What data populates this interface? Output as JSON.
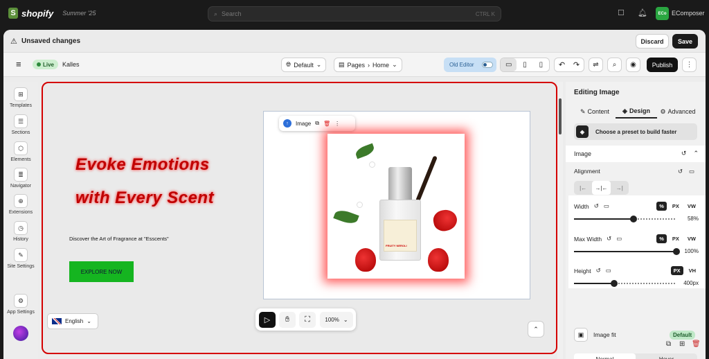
{
  "topbar": {
    "brand": "shopify",
    "store": "Summer '25",
    "search_placeholder": "Search",
    "shortcut": "CTRL K",
    "app_badge": "ECo",
    "app_name": "EComposer"
  },
  "unsaved": {
    "title": "Unsaved changes",
    "discard": "Discard",
    "save": "Save"
  },
  "toolbar": {
    "status": "Live",
    "shop": "Kalles",
    "theme": "Default",
    "page_group": "Pages",
    "page": "Home",
    "old_editor": "Old Editor",
    "publish": "Publish"
  },
  "leftbar": {
    "items": [
      {
        "label": "Templates",
        "icon": "templates-icon"
      },
      {
        "label": "Sections",
        "icon": "sections-icon"
      },
      {
        "label": "Elements",
        "icon": "elements-icon"
      },
      {
        "label": "Navigator",
        "icon": "navigator-icon"
      },
      {
        "label": "Extensions",
        "icon": "extensions-icon"
      },
      {
        "label": "History",
        "icon": "history-icon"
      },
      {
        "label": "Site Settings",
        "icon": "site-settings-icon"
      },
      {
        "label": "App Settings",
        "icon": "app-settings-icon"
      }
    ]
  },
  "canvas": {
    "heading_line1": "Evoke Emotions",
    "heading_line2": "with Every Scent",
    "subtext": "Discover the Art of Fragrance at \"Esscents\"",
    "cta": "EXPLORE NOW",
    "image_toolbar_label": "Image",
    "product_label": "FRUITY NEROLI",
    "language": "English",
    "zoom": "100%"
  },
  "panel": {
    "title": "Editing Image",
    "tabs": [
      "Content",
      "Design",
      "Advanced"
    ],
    "active_tab": "Design",
    "preset": "Choose a preset to build faster",
    "section": "Image",
    "alignment": "Alignment",
    "width": {
      "label": "Width",
      "units": [
        "%",
        "PX",
        "VW"
      ],
      "active": "%",
      "value": "58%",
      "fraction": 0.58
    },
    "max_width": {
      "label": "Max Width",
      "units": [
        "%",
        "PX",
        "VW"
      ],
      "active": "%",
      "value": "100%",
      "fraction": 1.0
    },
    "height": {
      "label": "Height",
      "units": [
        "PX",
        "VH"
      ],
      "active": "PX",
      "value": "400px",
      "fraction": 0.39
    },
    "image_fit": "Image fit",
    "image_fit_value": "Default",
    "state_tabs": [
      "Normal",
      "Hover"
    ]
  },
  "colors": {
    "accent_red": "#d40000",
    "cta_green": "#15b520",
    "live_green": "#2d8a3c",
    "app_green": "#2aa641"
  }
}
